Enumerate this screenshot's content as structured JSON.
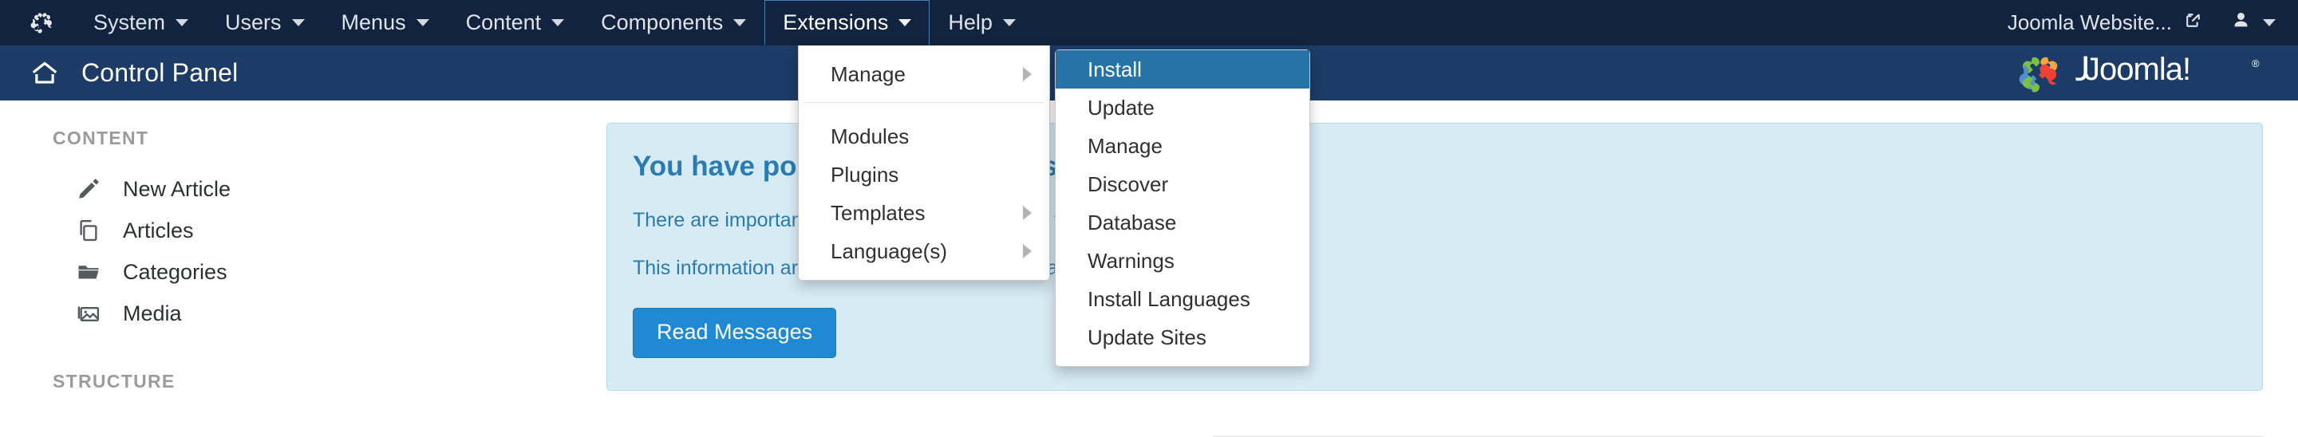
{
  "topbar": {
    "logo_icon": "joomla-mark-icon",
    "menu": [
      {
        "label": "System",
        "icon": "chevron-down-icon",
        "open": false
      },
      {
        "label": "Users",
        "icon": "chevron-down-icon",
        "open": false
      },
      {
        "label": "Menus",
        "icon": "chevron-down-icon",
        "open": false
      },
      {
        "label": "Content",
        "icon": "chevron-down-icon",
        "open": false
      },
      {
        "label": "Components",
        "icon": "chevron-down-icon",
        "open": false
      },
      {
        "label": "Extensions",
        "icon": "chevron-down-icon",
        "open": true
      },
      {
        "label": "Help",
        "icon": "chevron-down-icon",
        "open": false
      }
    ],
    "site_link_label": "Joomla Website...",
    "site_link_icon": "external-link-icon",
    "user_icon": "user-icon",
    "user_caret_icon": "chevron-down-icon"
  },
  "header": {
    "home_icon": "home-icon",
    "title": "Control Panel",
    "brand_name": "Joomla!",
    "brand_icon": "joomla-logo-icon"
  },
  "sidebar": {
    "sections": [
      {
        "heading": "CONTENT",
        "items": [
          {
            "label": "New Article",
            "icon": "pencil-icon"
          },
          {
            "label": "Articles",
            "icon": "copy-icon"
          },
          {
            "label": "Categories",
            "icon": "folder-open-icon"
          },
          {
            "label": "Media",
            "icon": "image-icon"
          }
        ]
      },
      {
        "heading": "STRUCTURE",
        "items": []
      }
    ]
  },
  "main": {
    "info_panel": {
      "title": "You have post-installation messages",
      "line1": "There are important post-installation messages that require your attention.",
      "line2": "This information area won't appear when you have hidden all the messages.",
      "button_label": "Read Messages"
    }
  },
  "dropdowns": {
    "extensions": {
      "items": [
        {
          "label": "Manage",
          "has_submenu": true,
          "divider_after": true,
          "active": false
        },
        {
          "label": "Modules",
          "has_submenu": false,
          "divider_after": false,
          "active": false
        },
        {
          "label": "Plugins",
          "has_submenu": false,
          "divider_after": false,
          "active": false
        },
        {
          "label": "Templates",
          "has_submenu": true,
          "divider_after": false,
          "active": false
        },
        {
          "label": "Language(s)",
          "has_submenu": true,
          "divider_after": false,
          "active": false
        }
      ]
    },
    "manage_submenu": {
      "items": [
        {
          "label": "Install",
          "active": true
        },
        {
          "label": "Update",
          "active": false
        },
        {
          "label": "Manage",
          "active": false
        },
        {
          "label": "Discover",
          "active": false
        },
        {
          "label": "Database",
          "active": false
        },
        {
          "label": "Warnings",
          "active": false
        },
        {
          "label": "Install Languages",
          "active": false
        },
        {
          "label": "Update Sites",
          "active": false
        }
      ]
    }
  },
  "colors": {
    "topbar_bg": "#12233f",
    "subhead_bg": "#1c3b66",
    "accent": "#2573a7",
    "info_bg": "#d7ebf4",
    "info_text": "#2b7bb0",
    "button_bg": "#2089d4"
  }
}
